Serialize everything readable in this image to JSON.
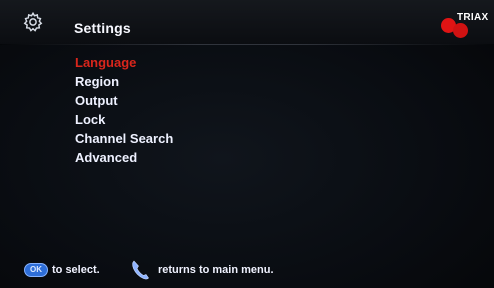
{
  "header": {
    "title": "Settings",
    "brand": "TRIAX",
    "icon": "gear-icon"
  },
  "menu": {
    "selected_index": 0,
    "items": [
      {
        "label": "Language"
      },
      {
        "label": "Region"
      },
      {
        "label": "Output"
      },
      {
        "label": "Lock"
      },
      {
        "label": "Channel Search"
      },
      {
        "label": "Advanced"
      }
    ]
  },
  "footer": {
    "ok_label": "OK",
    "select_hint": "to select.",
    "return_hint": "returns to main menu.",
    "return_icon": "phone-icon"
  },
  "colors": {
    "selected": "#d9261c",
    "text": "#eef1ff",
    "brand_red": "#e01414",
    "ok_button": "#2e6ed8"
  }
}
